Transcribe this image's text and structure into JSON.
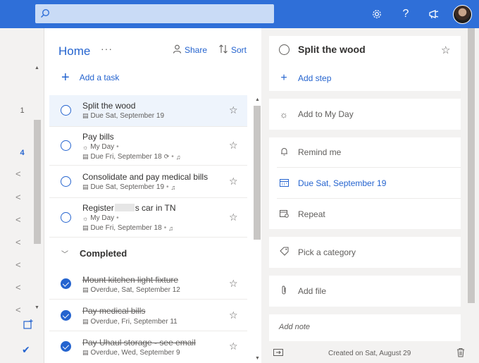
{
  "topbar": {
    "search_placeholder": "",
    "icons": [
      "search-icon",
      "settings-icon",
      "help-icon",
      "megaphone-icon"
    ],
    "accent_color": "#2f6fd8"
  },
  "rail": {
    "numbers": [
      {
        "label": "1"
      },
      {
        "label": "4"
      }
    ]
  },
  "list": {
    "title": "Home",
    "more": "···",
    "share_label": "Share",
    "sort_label": "Sort",
    "add_task_label": "Add a task",
    "tasks": [
      {
        "title": "Split the wood",
        "due": "Due Sat, September 19",
        "myday": ""
      },
      {
        "title": "Pay bills",
        "myday": "My Day",
        "due": "Due Fri, September 18"
      },
      {
        "title": "Consolidate and pay medical bills",
        "due": "Due Sat, September 19",
        "myday": ""
      },
      {
        "title_pre": "Register",
        "title_post": "s car in TN",
        "myday": "My Day",
        "due": "Due Fri, September 18"
      }
    ],
    "completed_label": "Completed",
    "completed_tasks": [
      {
        "title": "Mount kitchen light fixture",
        "due": "Overdue, Sat, September 12"
      },
      {
        "title": "Pay medical bills",
        "due": "Overdue, Fri, September 11"
      },
      {
        "title": "Pay Uhaul storage - see email",
        "due": "Overdue, Wed, September 9"
      }
    ]
  },
  "detail": {
    "task_title": "Split the wood",
    "add_step": "Add step",
    "add_to_my_day": "Add to My Day",
    "remind_me": "Remind me",
    "due_date": "Due Sat, September 19",
    "repeat": "Repeat",
    "pick_category": "Pick a category",
    "add_file": "Add file",
    "add_note": "Add note",
    "created": "Created on Sat, August 29"
  }
}
